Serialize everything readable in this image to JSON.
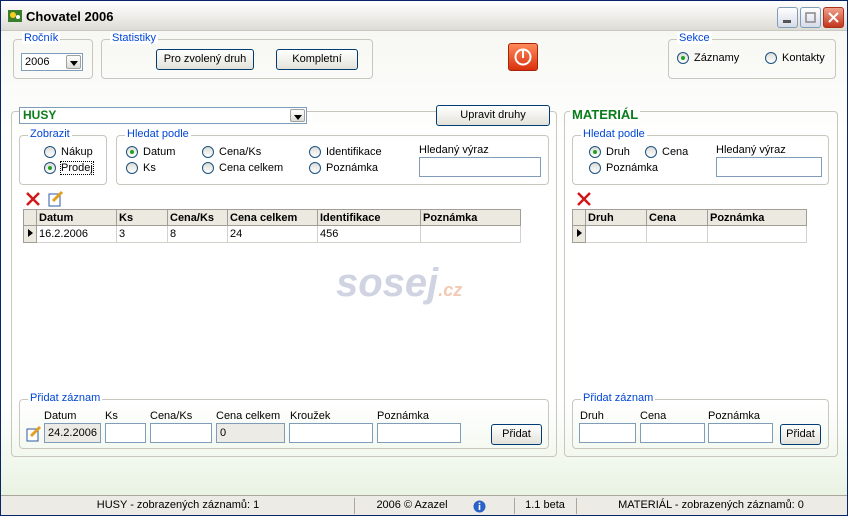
{
  "window": {
    "title": "Chovatel 2006"
  },
  "rocnik": {
    "title": "Ročník",
    "value": "2006"
  },
  "statistiky": {
    "title": "Statistiky",
    "btn1": "Pro zvolený druh",
    "btn2": "Kompletní"
  },
  "sekce": {
    "title": "Sekce",
    "opt1": "Záznamy",
    "opt2": "Kontakty"
  },
  "left": {
    "druh": "HUSY",
    "edit_button": "Upravit druhy",
    "zobrazit": {
      "title": "Zobrazit",
      "opt1": "Nákup",
      "opt2": "Prodej"
    },
    "hledat": {
      "title": "Hledat podle",
      "o1": "Datum",
      "o2": "Ks",
      "o3": "Cena/Ks",
      "o4": "Cena celkem",
      "o5": "Identifikace",
      "o6": "Poznámka",
      "search_label": "Hledaný výraz"
    },
    "columns": [
      "Datum",
      "Ks",
      "Cena/Ks",
      "Cena celkem",
      "Identifikace",
      "Poznámka"
    ],
    "rows": [
      [
        "16.2.2006",
        "3",
        "8",
        "24",
        "456",
        ""
      ]
    ],
    "pridat": {
      "title": "Přidat záznam",
      "l1": "Datum",
      "l2": "Ks",
      "l3": "Cena/Ks",
      "l4": "Cena celkem",
      "l5": "Kroužek",
      "l6": "Poznámka",
      "datum": "24.2.2006",
      "cena_celkem": "0",
      "button": "Přidat"
    }
  },
  "right": {
    "title": "MATERIÁL",
    "hledat": {
      "title": "Hledat podle",
      "o1": "Druh",
      "o2": "Cena",
      "o3": "Poznámka",
      "search_label": "Hledaný výraz"
    },
    "columns": [
      "Druh",
      "Cena",
      "Poznámka"
    ],
    "pridat": {
      "title": "Přidat záznam",
      "l1": "Druh",
      "l2": "Cena",
      "l3": "Poznámka",
      "button": "Přidat"
    }
  },
  "status": {
    "left": "HUSY - zobrazených záznamů: 1",
    "center": "2006 © Azazel",
    "version": "1.1 beta",
    "right": "MATERIÁL - zobrazených záznamů: 0"
  },
  "watermark": {
    "main": "sosej",
    "tld": ".cz"
  }
}
